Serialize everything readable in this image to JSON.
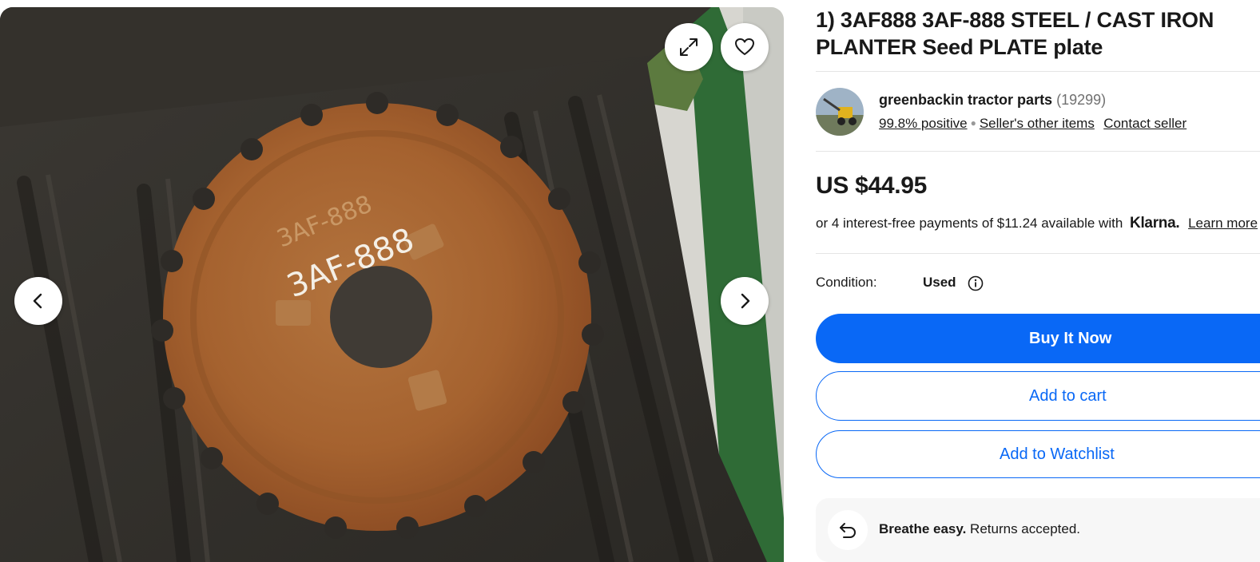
{
  "listing": {
    "title": "1) 3AF888 3AF-888 STEEL / CAST IRON PLANTER Seed PLATE plate"
  },
  "gallery": {
    "icons": {
      "expand": "expand-icon",
      "watch": "heart-icon",
      "prev": "chevron-left-icon",
      "next": "chevron-right-icon"
    },
    "photo_markings": [
      "3AF-888",
      "3AF-888"
    ]
  },
  "seller": {
    "name": "greenbackin tractor parts",
    "feedback_count": "(19299)",
    "positive": "99.8% positive",
    "other_items": "Seller's other items",
    "contact": "Contact seller"
  },
  "pricing": {
    "price": "US $44.95",
    "installments": "or 4 interest-free payments of $11.24 available with",
    "klarna": "Klarna.",
    "learn_more": "Learn more"
  },
  "condition": {
    "label": "Condition:",
    "value": "Used",
    "info_icon": "info-icon"
  },
  "actions": {
    "buy": "Buy It Now",
    "cart": "Add to cart",
    "watchlist": "Add to Watchlist"
  },
  "returns": {
    "headline": "Breathe easy.",
    "text": "Returns accepted.",
    "icon": "return-arrow-icon"
  },
  "colors": {
    "primary": "#0968f6",
    "text": "#191919",
    "muted": "#707070",
    "panel": "#f7f7f7"
  }
}
